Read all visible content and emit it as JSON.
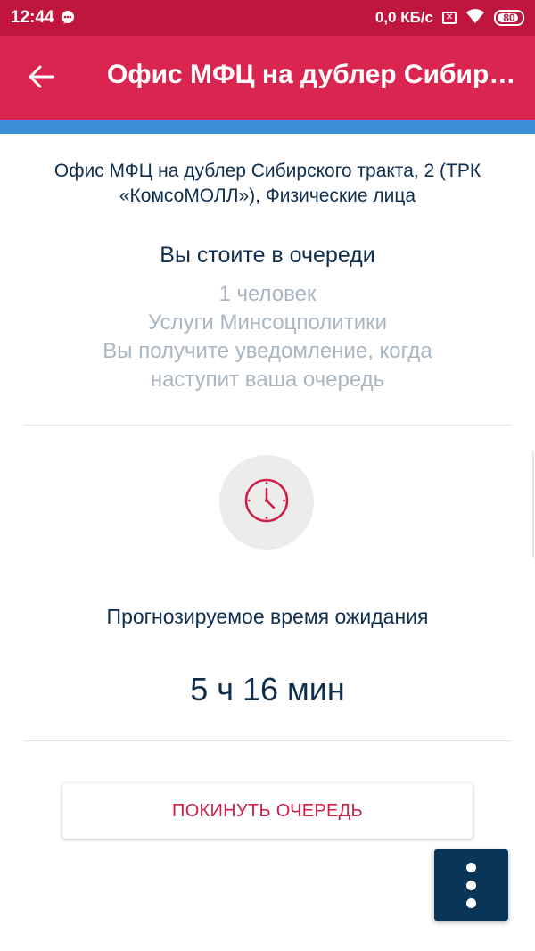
{
  "status_bar": {
    "time": "12:44",
    "network_speed": "0,0 КБ/с",
    "battery": "80",
    "icons": [
      "notification-icon",
      "sim-icon",
      "wifi-icon",
      "battery-icon"
    ]
  },
  "app_bar": {
    "title": "Офис МФЦ на дублер Сибир…",
    "back_icon": "arrow-left-icon"
  },
  "office": {
    "name": "Офис МФЦ на дублер Сибирского тракта, 2 (ТРК «КомсоМОЛЛ»), Физические лица"
  },
  "queue": {
    "heading": "Вы стоите в очереди",
    "people": "1 человек",
    "service": "Услуги Минсоцполитики",
    "notice_line1": "Вы получите уведомление, когда",
    "notice_line2": "наступит ваша очередь"
  },
  "wait": {
    "icon": "clock-icon",
    "label": "Прогнозируемое время ожидания",
    "value": "5 ч 16 мин"
  },
  "actions": {
    "leave_label": "ПОКИНУТЬ ОЧЕРЕДЬ",
    "menu_icon": "more-vertical-icon"
  },
  "colors": {
    "status_bar": "#c0163e",
    "app_bar": "#d9254f",
    "accent_strip": "#3a8fd6",
    "text_primary": "#0f2f4e",
    "text_muted": "#a9b6c2",
    "button_text": "#d01e48",
    "fab": "#0b3556"
  }
}
